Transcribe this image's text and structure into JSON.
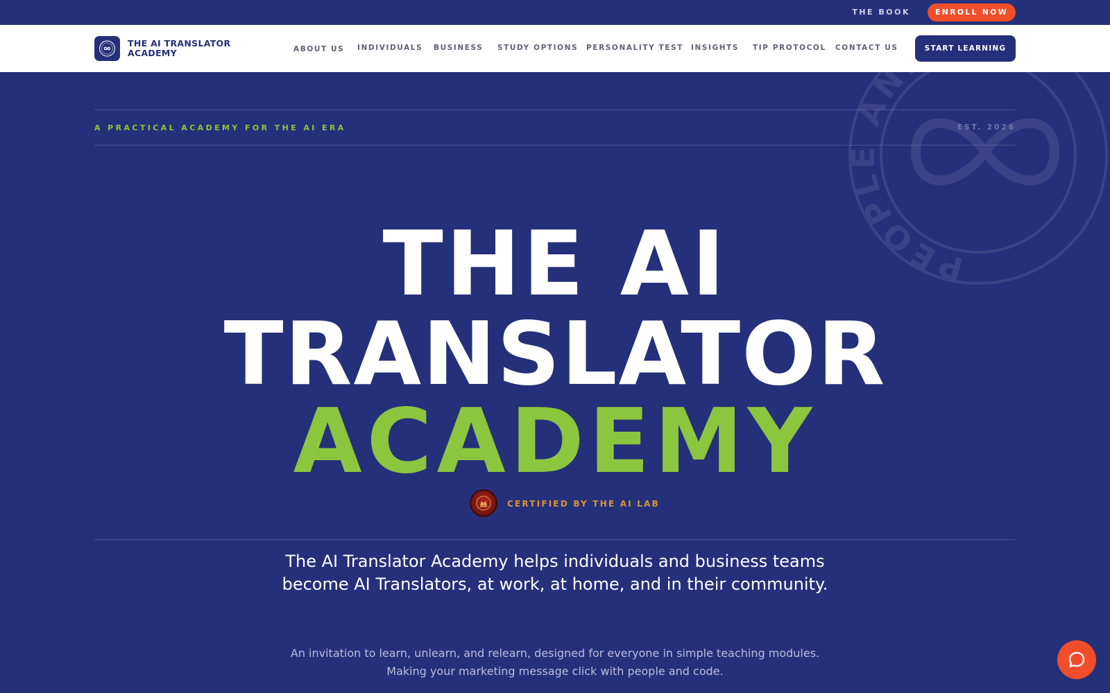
{
  "utility_bar": {
    "book_label": "THE BOOK",
    "enroll_label": "ENROLL NOW"
  },
  "nav": {
    "brand_line1": "THE AI TRANSLATOR",
    "brand_line2": "ACADEMY",
    "links": [
      {
        "label": "ABOUT US"
      },
      {
        "label": "INDIVIDUALS"
      },
      {
        "label": "BUSINESS"
      },
      {
        "label": "STUDY OPTIONS"
      },
      {
        "label": "PERSONALITY TEST"
      },
      {
        "label": "INSIGHTS"
      },
      {
        "label": "TIP PROTOCOL"
      },
      {
        "label": "CONTACT US"
      }
    ],
    "cta_label": "START LEARNING"
  },
  "hero": {
    "tagline": "A PRACTICAL ACADEMY FOR THE AI ERA",
    "est": "EST. 2026",
    "headline_line1": "THE AI",
    "headline_line2": "TRANSLATOR",
    "headline_line3": "ACADEMY",
    "certified": "CERTIFIED BY THE AI LAB",
    "lead": "The AI Translator Academy helps individuals and business teams become AI Translators, at work, at home, and in their community.",
    "sub": "An invitation to learn, unlearn, and relearn, designed for everyone in simple teaching modules. Making your marketing message click with people and code.",
    "stamp_text": "PEOPLE AND CODE"
  },
  "colors": {
    "primary": "#25307a",
    "accent_green": "#8cc63f",
    "accent_orange": "#f04e2a",
    "gold": "#d9943a"
  },
  "icons": {
    "logo": "infinity-badge-icon",
    "seal": "crest-seal-icon",
    "chat": "chat-bubble-icon"
  }
}
